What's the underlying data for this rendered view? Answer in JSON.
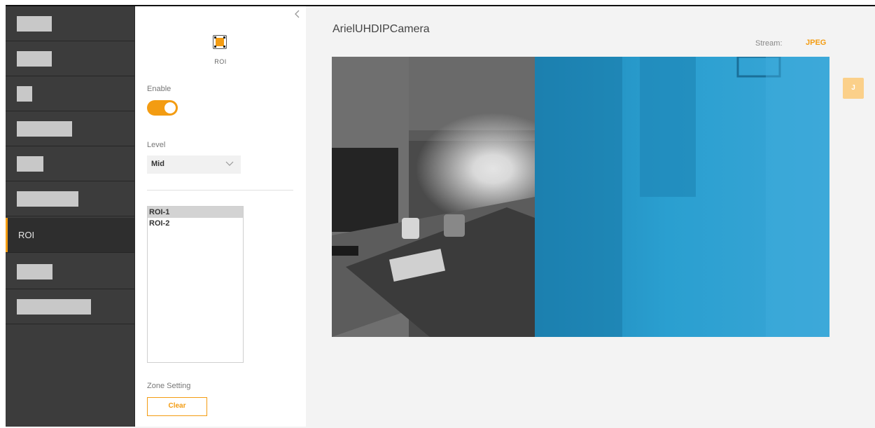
{
  "nav": {
    "items": [
      {
        "label": ""
      },
      {
        "label": ""
      },
      {
        "label": ""
      },
      {
        "label": ""
      },
      {
        "label": ""
      },
      {
        "label": ""
      },
      {
        "label": "ROI",
        "active": true
      },
      {
        "label": ""
      },
      {
        "label": ""
      }
    ]
  },
  "panel": {
    "icon": "roi-icon",
    "icon_caption": "ROI",
    "enable_label": "Enable",
    "enable_on": true,
    "level_label": "Level",
    "level_value": "Mid",
    "roi_list": [
      "ROI-1",
      "ROI-2"
    ],
    "selected_roi": "ROI-1",
    "zone_label": "Zone Setting",
    "clear_label": "Clear"
  },
  "main": {
    "camera_name": "ArielUHDIPCamera",
    "stream_label": "Stream:",
    "stream_value": "JPEG",
    "side_button_label": "J"
  },
  "colors": {
    "accent": "#f39c12",
    "nav_bg": "#3c3c3c",
    "roi_overlay": "#1c8ec6"
  }
}
